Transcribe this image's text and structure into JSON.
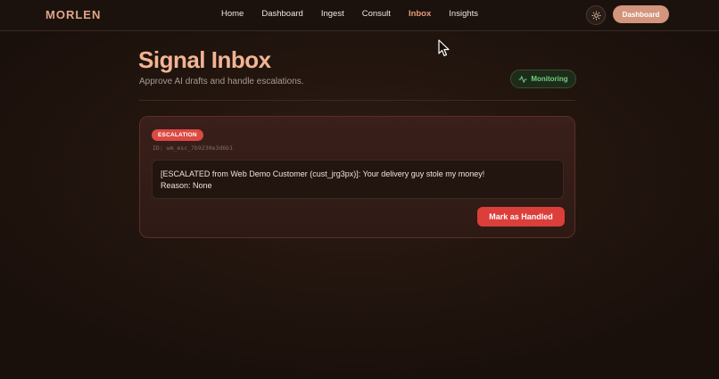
{
  "brand": "MORLEN",
  "nav": {
    "items": [
      "Home",
      "Dashboard",
      "Ingest",
      "Consult",
      "Inbox",
      "Insights"
    ],
    "active": "Inbox"
  },
  "header": {
    "theme_icon": "sun-icon",
    "dashboard_label": "Dashboard"
  },
  "page": {
    "title": "Signal Inbox",
    "subtitle": "Approve AI drafts and handle escalations.",
    "status_label": "Monitoring",
    "status_icon": "activity-icon"
  },
  "card": {
    "badge": "ESCALATION",
    "id_text": "ID: wm_esc_7b9230e3d6b1",
    "message_line1": "[ESCALATED from Web Demo Customer (cust_jrg3px)]: Your delivery guy stole my money!",
    "message_line2": "Reason: None",
    "action_label": "Mark as Handled"
  },
  "colors": {
    "accent": "#e49b7c",
    "title": "#f2b493",
    "danger": "#dc3e3a",
    "success": "#6fd17a",
    "background": "#24160f"
  }
}
